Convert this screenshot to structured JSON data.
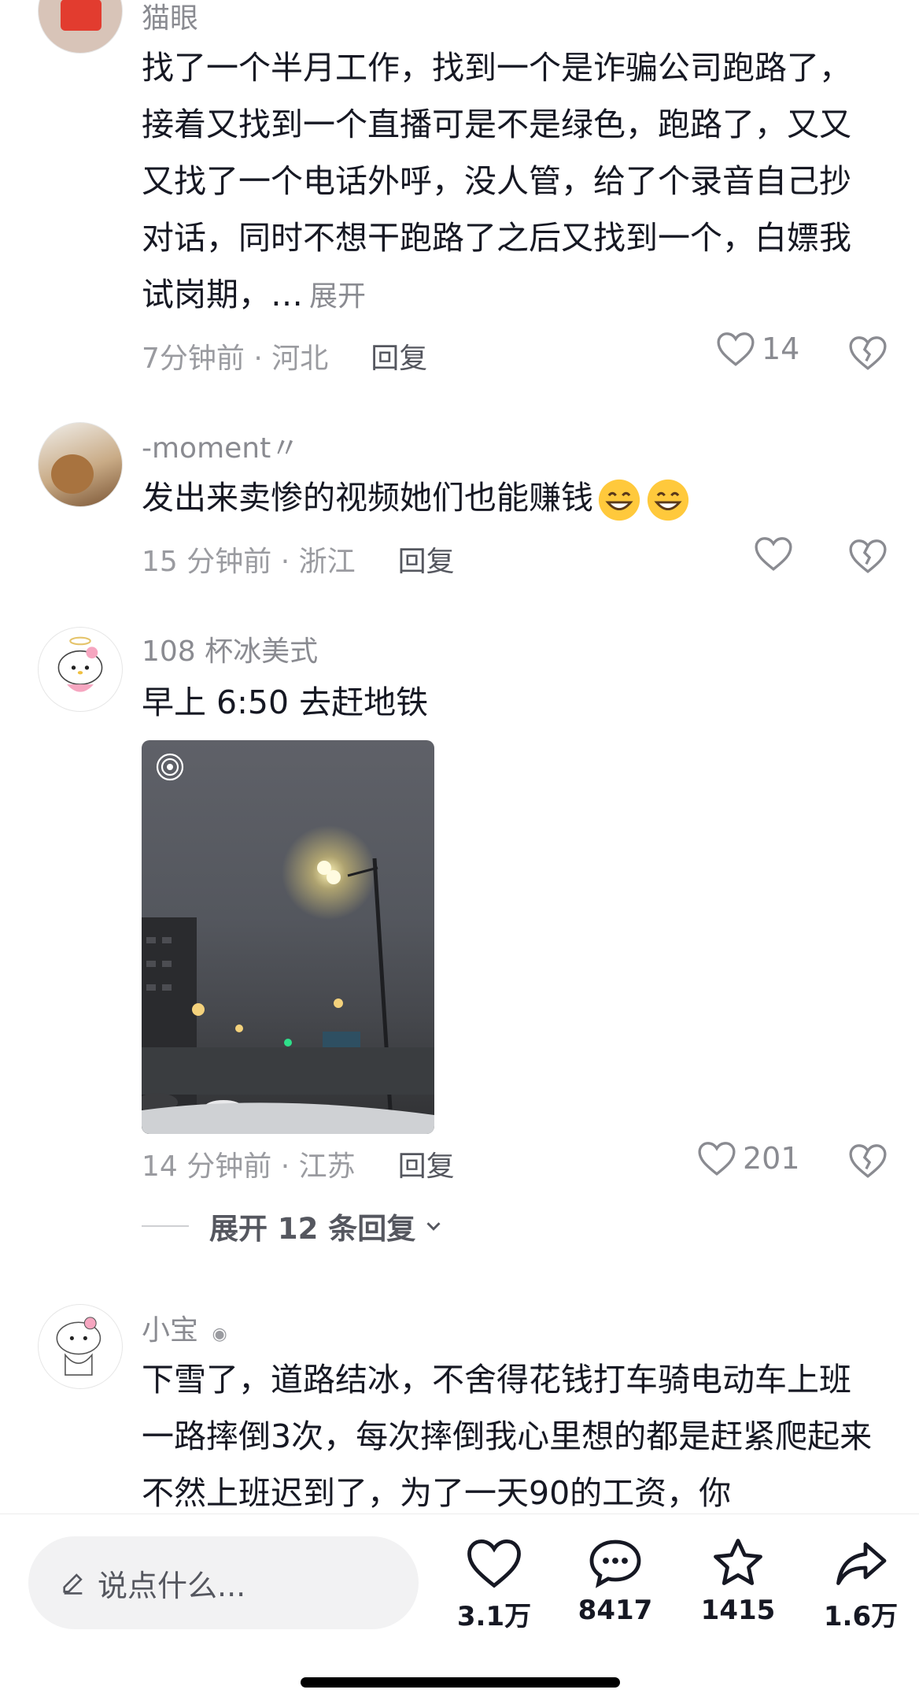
{
  "comments": [
    {
      "username": "猫眼",
      "text": "找了一个半月工作，找到一个是诈骗公司跑路了，接着又找到一个直播可是不是绿色，跑路了，又又又找了一个电话外呼，没人管，给了个录音自己抄对话，同时不想干跑路了之后又找到一个，白嫖我试岗期，…",
      "expand": "展开",
      "time_location": "7分钟前 · 河北",
      "reply": "回复",
      "likes": "14"
    },
    {
      "username": "-moment〃",
      "text": "发出来卖惨的视频她们也能赚钱",
      "time_location": "15 分钟前 · 浙江",
      "reply": "回复",
      "likes": ""
    },
    {
      "username": "108 杯冰美式",
      "text": "早上 6:50 去赶地铁",
      "time_location": "14 分钟前 · 江苏",
      "reply": "回复",
      "likes": "201",
      "expand_replies": "展开 12 条回复"
    },
    {
      "username": "小宝",
      "text": "下雪了，道路结冰，不舍得花钱打车骑电动车上班一路摔倒3次，每次摔倒我心里想的都是赶紧爬起来不然上班迟到了，为了一天90的工资，你"
    }
  ],
  "bottom_bar": {
    "input_placeholder": "说点什么...",
    "like_count": "3.1万",
    "comment_count": "8417",
    "star_count": "1415",
    "share_count": "1.6万"
  },
  "icons": {
    "like": "heart-outline-icon",
    "dislike": "broken-heart-icon",
    "comment": "comment-bubble-icon",
    "star": "star-outline-icon",
    "share": "share-arrow-icon",
    "edit": "pencil-icon",
    "chevron": "chevron-down-icon",
    "emoji": "grinning-emoji-icon"
  },
  "colors": {
    "text": "#161823",
    "meta": "#9a9ba0",
    "input_bg": "#f2f2f3"
  }
}
